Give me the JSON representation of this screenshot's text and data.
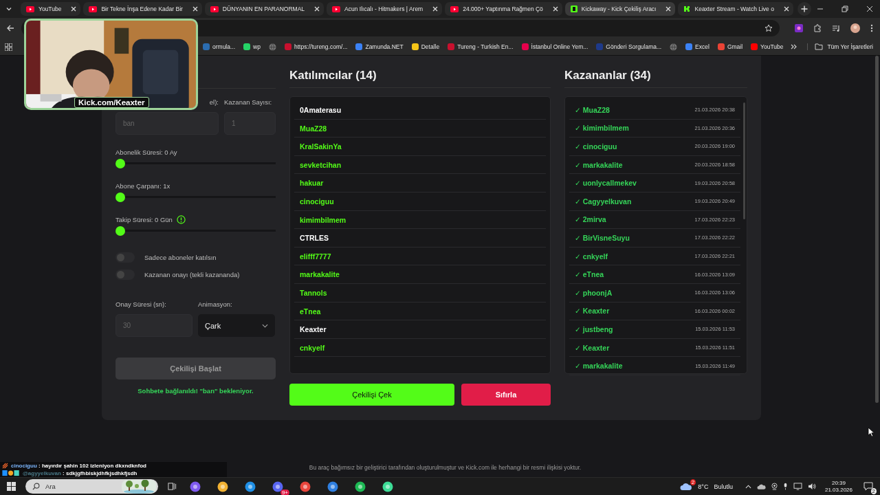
{
  "browser": {
    "tabs": [
      {
        "kind": "video",
        "title": "YouTube",
        "selected": false
      },
      {
        "kind": "video",
        "title": "Bir Tekne İnşa Edene Kadar Bir",
        "selected": false
      },
      {
        "kind": "video",
        "title": "DÜNYANIN EN PARANORMAL",
        "selected": false
      },
      {
        "kind": "video",
        "title": "Acun Ilıcalı - Hitmakers | Arem",
        "selected": false
      },
      {
        "kind": "video",
        "title": "24.000+ Yaptınma Rağmen Çö",
        "selected": false
      },
      {
        "kind": "app",
        "title": "Kickaway - Kick Çekiliş Aracı",
        "selected": true
      },
      {
        "kind": "stream",
        "title": "Keaxter Stream - Watch Live o",
        "selected": false
      }
    ],
    "bookmarks": [
      {
        "kind": "site",
        "label": "ormula...",
        "color": "#2b6cb0"
      },
      {
        "kind": "site",
        "label": "wp",
        "color": "#25d366"
      },
      {
        "kind": "globe"
      },
      {
        "kind": "site",
        "label": "https://tureng.com/...",
        "color": "#c8102e"
      },
      {
        "kind": "site",
        "label": "Zamunda.NET",
        "color": "#3b82f6"
      },
      {
        "kind": "site",
        "label": "Detalle",
        "color": "#f5c518"
      },
      {
        "kind": "site",
        "label": "Tureng - Turkish En...",
        "color": "#c8102e"
      },
      {
        "kind": "site",
        "label": "İstanbul Online Yem...",
        "color": "#e6004c"
      },
      {
        "kind": "site",
        "label": "Gönderi Sorgulama...",
        "color": "#1e3a8a"
      },
      {
        "kind": "globe"
      },
      {
        "kind": "site",
        "label": "Excel",
        "color": "#3b82f6"
      },
      {
        "kind": "site",
        "label": "Gmail",
        "color": "#ea4335"
      },
      {
        "kind": "site",
        "label": "YouTube",
        "color": "#ff0000"
      }
    ],
    "all_bookmarks": "Tüm Yer İşaretleri"
  },
  "webcam": {
    "caption": "Kick.com/Keaxter"
  },
  "settings": {
    "keyword_label": "el):",
    "keyword_placeholder": "ban",
    "winners_label": "Kazanan Sayısı:",
    "winners_placeholder": "1",
    "sliders": [
      {
        "label": "Abonelik Süresi: 0 Ay",
        "level": 0,
        "info": false
      },
      {
        "label": "Abone Çarpanı: 1x",
        "level": 0,
        "info": false
      },
      {
        "label": "Takip Süresi:  0  Gün",
        "level": 0,
        "info": true
      }
    ],
    "toggles": [
      {
        "label": "Sadece aboneler katılsın",
        "on": false
      },
      {
        "label": "Kazanan onayı (tekli kazananda)",
        "on": false
      }
    ],
    "confirm_label": "Onay Süresi (sn):",
    "confirm_placeholder": "30",
    "animation_label": "Animasyon:",
    "animation_value": "Çark",
    "start_button": "Çekilişi Başlat",
    "status": "Sohbete bağlanıldı! \"ban\" bekleniyor."
  },
  "participants": {
    "title": "Katılımcılar (14)",
    "items": [
      {
        "name": "0Amaterasu",
        "color": "#ffffff"
      },
      {
        "name": "MuaZ28",
        "color": "#53fc18"
      },
      {
        "name": "KralSakinYa",
        "color": "#53fc18"
      },
      {
        "name": "sevketcihan",
        "color": "#53fc18"
      },
      {
        "name": "hakuar",
        "color": "#53fc18"
      },
      {
        "name": "cinociguu",
        "color": "#53fc18"
      },
      {
        "name": "kimimbilmem",
        "color": "#53fc18"
      },
      {
        "name": "CTRLES",
        "color": "#ffffff"
      },
      {
        "name": "elifff7777",
        "color": "#53fc18"
      },
      {
        "name": "markakalite",
        "color": "#53fc18"
      },
      {
        "name": "Tannols",
        "color": "#53fc18"
      },
      {
        "name": "eTnea",
        "color": "#53fc18"
      },
      {
        "name": "Keaxter",
        "color": "#ffffff"
      },
      {
        "name": "cnkyelf",
        "color": "#53fc18"
      }
    ],
    "draw_button": "Çekilişi Çek",
    "reset_button": "Sıfırla"
  },
  "winners": {
    "title": "Kazananlar (34)",
    "items": [
      {
        "mark": "✓",
        "name": "MuaZ28",
        "time": "21.03.2026 20:38"
      },
      {
        "mark": "✓",
        "name": "kimimbilmem",
        "time": "21.03.2026 20:36"
      },
      {
        "mark": "✓",
        "name": "cinociguu",
        "time": "20.03.2026 19:00"
      },
      {
        "mark": "✓",
        "name": "markakalite",
        "time": "20.03.2026 18:58"
      },
      {
        "mark": "✓",
        "name": "uonlycallmekev",
        "time": "19.03.2026 20:58"
      },
      {
        "mark": "✓",
        "name": "Cagyyelkuvan",
        "time": "19.03.2026 20:49"
      },
      {
        "mark": "✓",
        "name": "2mirva",
        "time": "17.03.2026 22:23"
      },
      {
        "mark": "✓",
        "name": "BirVisneSuyu",
        "time": "17.03.2026 22:22"
      },
      {
        "mark": "✓",
        "name": "cnkyelf",
        "time": "17.03.2026 22:21"
      },
      {
        "mark": "✓",
        "name": "eTnea",
        "time": "16.03.2026 13:09"
      },
      {
        "mark": "✓",
        "name": "phoonjA",
        "time": "16.03.2026 13:06"
      },
      {
        "mark": "✓",
        "name": "Keaxter",
        "time": "16.03.2026 00:02"
      },
      {
        "mark": "✓",
        "name": "justbeng",
        "time": "15.03.2026 11:53"
      },
      {
        "mark": "✓",
        "name": "Keaxter",
        "time": "15.03.2026 11:51"
      },
      {
        "mark": "✓",
        "name": "markakalite",
        "time": "15.03.2026 11:49"
      }
    ]
  },
  "footer": "Bu araç bağımsız bir geliştirici tarafından oluşturulmuştur ve Kick.com ile herhangi bir resmi ilişkisi yoktur.",
  "chat_overlay": [
    {
      "user": "cinociguu",
      "text": ": hayırdır şahin 102 izleniyon dkxndknfod"
    },
    {
      "user": "@agyyelkuvan",
      "text": ": sdkjgfhbiskjdhfkjsdhkfjsdh"
    }
  ],
  "taskbar": {
    "search_placeholder": "Ara",
    "app_badge": "9+",
    "weather_badge": "2",
    "temperature": "8°C",
    "weather": "Bulutlu",
    "time": "20:39",
    "date": "21.03.2026",
    "notifications": "2"
  }
}
